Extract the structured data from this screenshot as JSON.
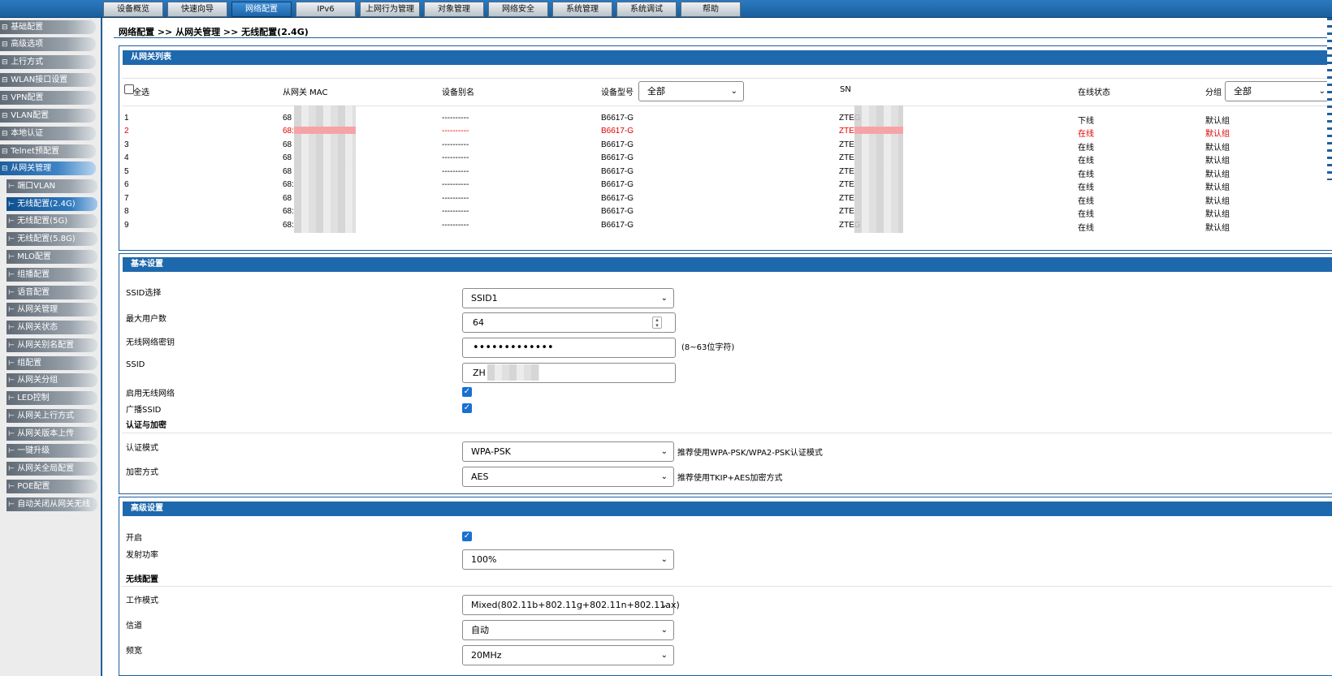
{
  "top_nav": [
    "设备概览",
    "快速向导",
    "网络配置",
    "IPv6",
    "上网行为管理",
    "对象管理",
    "网络安全",
    "系统管理",
    "系统调试",
    "帮助"
  ],
  "top_nav_active": "网络配置",
  "sidebar": {
    "top_items": [
      "基础配置",
      "高级选项",
      "上行方式",
      "WLAN接口设置",
      "VPN配置",
      "VLAN配置",
      "本地认证",
      "Telnet预配置",
      "从网关管理"
    ],
    "sub_items": [
      "端口VLAN",
      "无线配置(2.4G)",
      "无线配置(5G)",
      "无线配置(5.8G)",
      "MLO配置",
      "组播配置",
      "语音配置",
      "从网关管理",
      "从网关状态",
      "从网关别名配置",
      "组配置",
      "从网关分组",
      "LED控制",
      "从网关上行方式",
      "从网关版本上传",
      "一键升级",
      "从网关全局配置",
      "POE配置",
      "自动关闭从网关无线"
    ],
    "top_marker": "⊟",
    "sub_marker": "⊢"
  },
  "breadcrumb": "网络配置 >> 从网关管理 >> 无线配置(2.4G)",
  "gateway_list": {
    "title": "从网关列表",
    "headers": {
      "select_all": "全选",
      "mac": "从网关 MAC",
      "alias": "设备别名",
      "model": "设备型号",
      "sn": "SN",
      "status": "在线状态",
      "group": "分组"
    },
    "model_filter": "全部",
    "group_filter": "全部",
    "rows": [
      {
        "no": "1",
        "mac": "68",
        "alias": "----------",
        "model": "B6617-G",
        "sn": "ZTEG",
        "status": "下线",
        "group": "默认组"
      },
      {
        "no": "2",
        "mac": "68:",
        "alias": "----------",
        "model": "B6617-G",
        "sn": "ZTE",
        "status": "在线",
        "group": "默认组"
      },
      {
        "no": "3",
        "mac": "68",
        "alias": "----------",
        "model": "B6617-G",
        "sn": "ZTE",
        "status": "在线",
        "group": "默认组"
      },
      {
        "no": "4",
        "mac": "68",
        "alias": "----------",
        "model": "B6617-G",
        "sn": "ZTE",
        "status": "在线",
        "group": "默认组"
      },
      {
        "no": "5",
        "mac": "68",
        "alias": "----------",
        "model": "B6617-G",
        "sn": "ZTE",
        "status": "在线",
        "group": "默认组"
      },
      {
        "no": "6",
        "mac": "68:",
        "alias": "----------",
        "model": "B6617-G",
        "sn": "ZTE",
        "status": "在线",
        "group": "默认组"
      },
      {
        "no": "7",
        "mac": "68",
        "alias": "----------",
        "model": "B6617-G",
        "sn": "ZTE",
        "status": "在线",
        "group": "默认组"
      },
      {
        "no": "8",
        "mac": "68:",
        "alias": "----------",
        "model": "B6617-G",
        "sn": "ZTE",
        "status": "在线",
        "group": "默认组"
      },
      {
        "no": "9",
        "mac": "68:",
        "alias": "----------",
        "model": "B6617-G",
        "sn": "ZTEG",
        "status": "在线",
        "group": "默认组"
      }
    ],
    "highlight_row": 2
  },
  "basic": {
    "title": "基本设置",
    "ssid_select_label": "SSID选择",
    "ssid_select_value": "SSID1",
    "max_users_label": "最大用户数",
    "max_users_value": "64",
    "password_label": "无线网络密钥",
    "password_value": "•••••••••••••",
    "password_hint": "(8~63位字符)",
    "ssid_label": "SSID",
    "ssid_value": "ZH",
    "enable_label": "启用无线网络",
    "broadcast_label": "广播SSID",
    "auth_section": "认证与加密",
    "auth_mode_label": "认证模式",
    "auth_mode_value": "WPA-PSK",
    "auth_mode_hint": "推荐使用WPA-PSK/WPA2-PSK认证模式",
    "encrypt_label": "加密方式",
    "encrypt_value": "AES",
    "encrypt_hint": "推荐使用TKIP+AES加密方式"
  },
  "advanced": {
    "title": "高级设置",
    "enable_label": "开启",
    "tx_power_label": "发射功率",
    "tx_power_value": "100%",
    "wireless_section": "无线配置",
    "mode_label": "工作模式",
    "mode_value": "Mixed(802.11b+802.11g+802.11n+802.11ax)",
    "channel_label": "信道",
    "channel_value": "自动",
    "bandwidth_label": "频宽",
    "bandwidth_value": "20MHz"
  },
  "colors": {
    "accent": "#1e68ad",
    "online_highlight": "#e00000"
  }
}
